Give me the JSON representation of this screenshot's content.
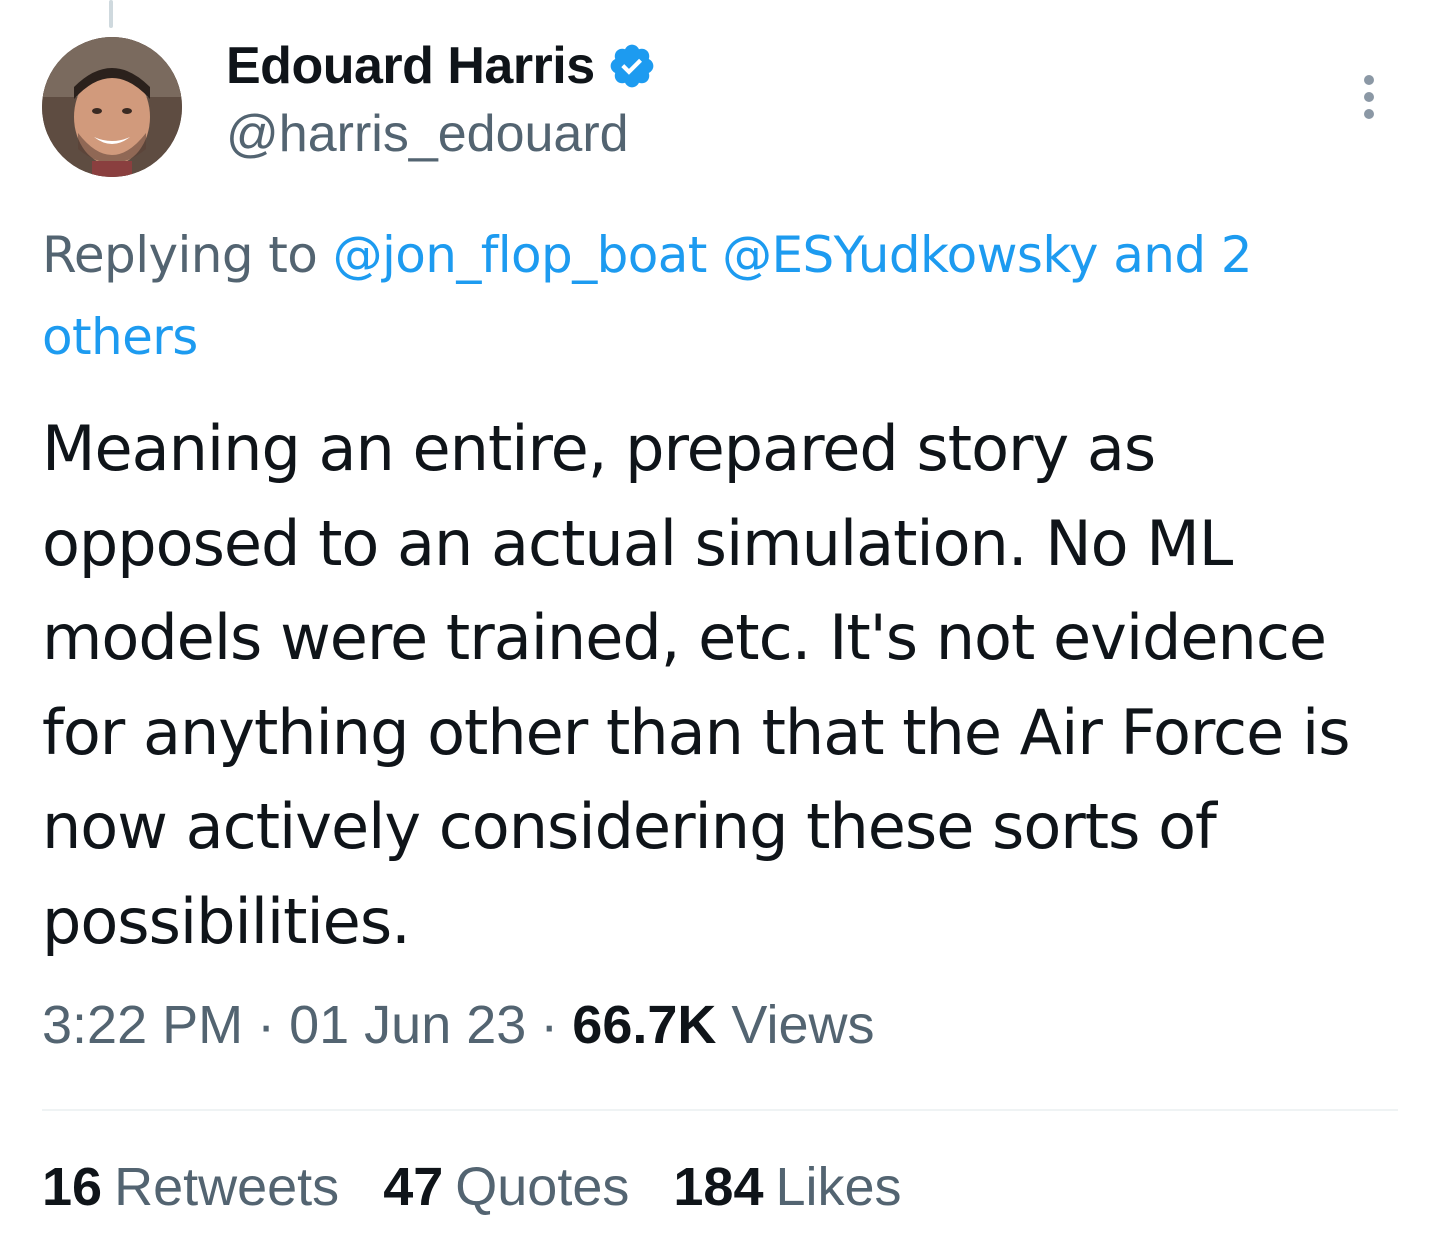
{
  "author": {
    "display_name": "Edouard Harris",
    "handle": "@harris_edouard",
    "verified": true
  },
  "reply_context": {
    "prefix": "Replying to",
    "mentions": [
      "@jon_flop_boat",
      "@ESYudkowsky"
    ],
    "connector": "and",
    "others": "2 others"
  },
  "tweet": {
    "text": "Meaning an entire, prepared story as opposed to an actual simulation. No ML models were trained, etc. It's not evidence for anything other than that the Air Force is now actively considering these sorts of possibilities."
  },
  "meta": {
    "time": "3:22 PM",
    "date": "01 Jun 23",
    "views_count": "66.7K",
    "views_label": "Views",
    "separator": "·"
  },
  "stats": {
    "retweets": {
      "count": "16",
      "label": "Retweets"
    },
    "quotes": {
      "count": "47",
      "label": "Quotes"
    },
    "likes": {
      "count": "184",
      "label": "Likes"
    }
  },
  "colors": {
    "accent": "#1d9bf0",
    "secondary_text": "#536471",
    "primary_text": "#0f1419",
    "divider": "#eff3f4"
  },
  "icons": [
    "verified-badge-icon",
    "more-options-icon"
  ]
}
